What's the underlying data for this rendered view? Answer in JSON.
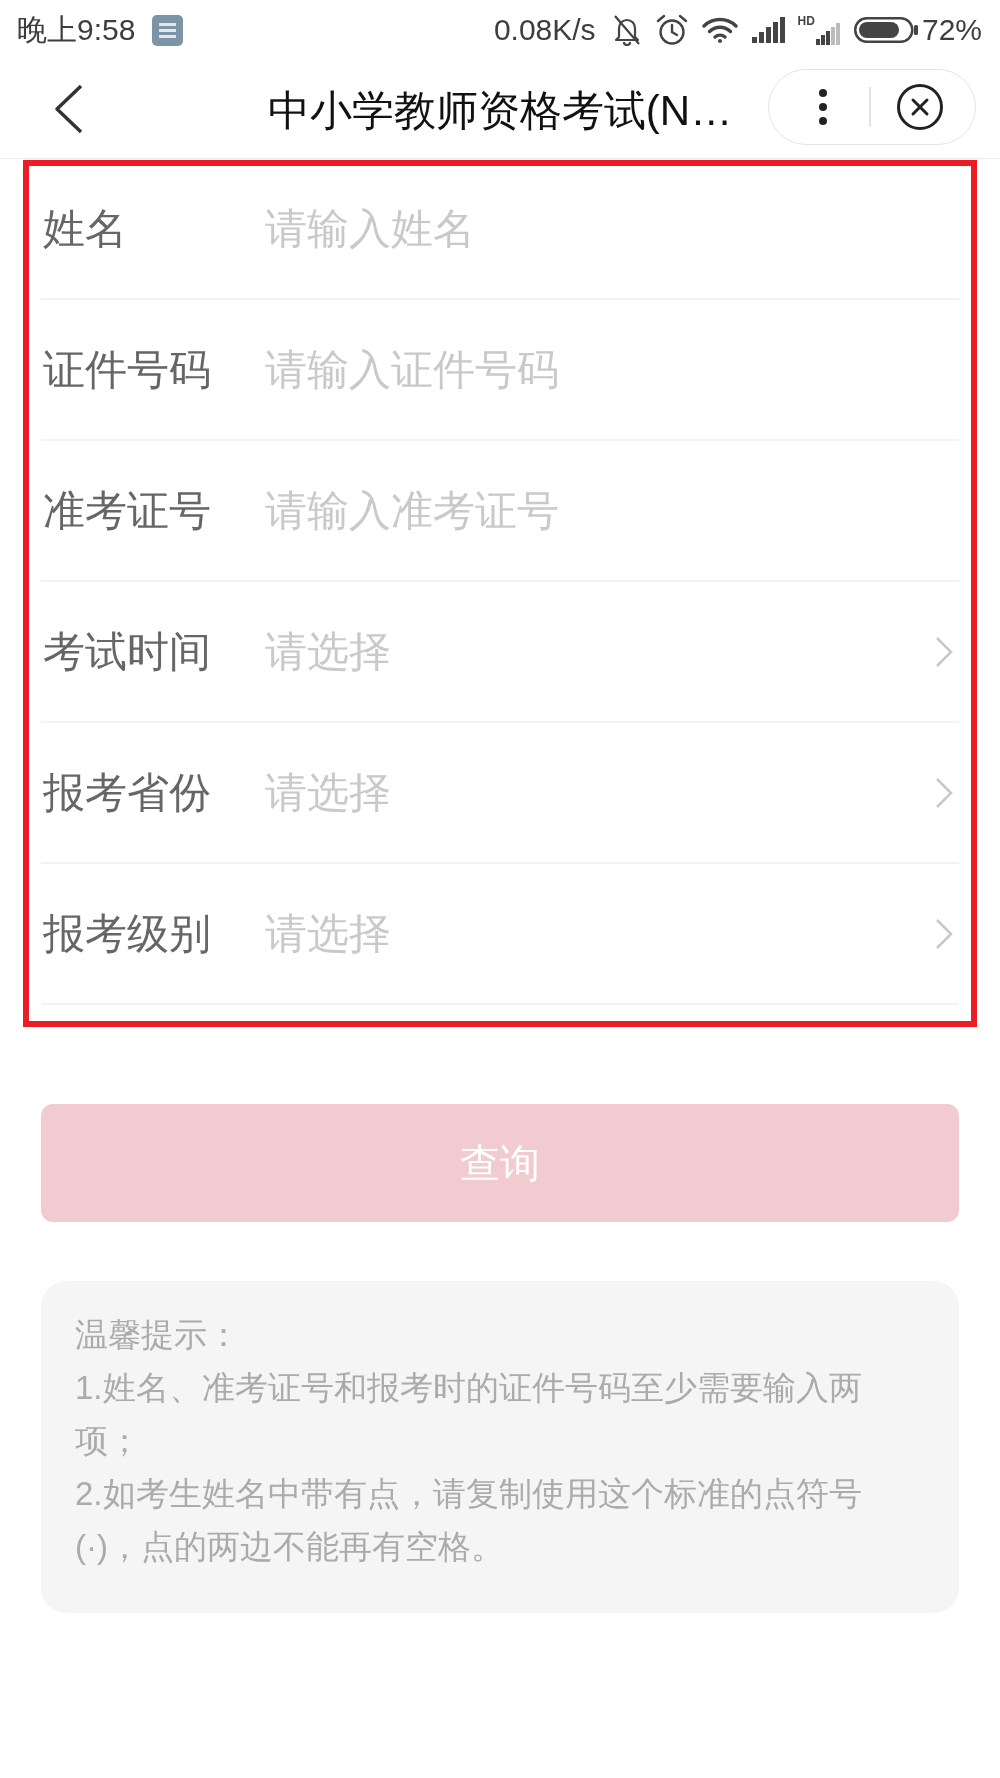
{
  "status_bar": {
    "time": "晚上9:58",
    "speed": "0.08K/s",
    "network_label": "HD",
    "battery": "72%"
  },
  "header": {
    "title": "中小学教师资格考试(N…"
  },
  "highlight_frame": true,
  "fields": [
    {
      "kind": "text",
      "label": "姓名",
      "placeholder": "请输入姓名"
    },
    {
      "kind": "text",
      "label": "证件号码",
      "placeholder": "请输入证件号码"
    },
    {
      "kind": "text",
      "label": "准考证号",
      "placeholder": "请输入准考证号"
    },
    {
      "kind": "select",
      "label": "考试时间",
      "placeholder": "请选择"
    },
    {
      "kind": "select",
      "label": "报考省份",
      "placeholder": "请选择"
    },
    {
      "kind": "select",
      "label": "报考级别",
      "placeholder": "请选择"
    }
  ],
  "query_button": {
    "label": "查询",
    "disabled": true
  },
  "tips": {
    "title": "温馨提示：",
    "items": [
      "1.姓名、准考证号和报考时的证件号码至少需要输入两项；",
      "2.如考生姓名中带有点，请复制使用这个标准的点符号(·)，点的两边不能再有空格。"
    ]
  }
}
